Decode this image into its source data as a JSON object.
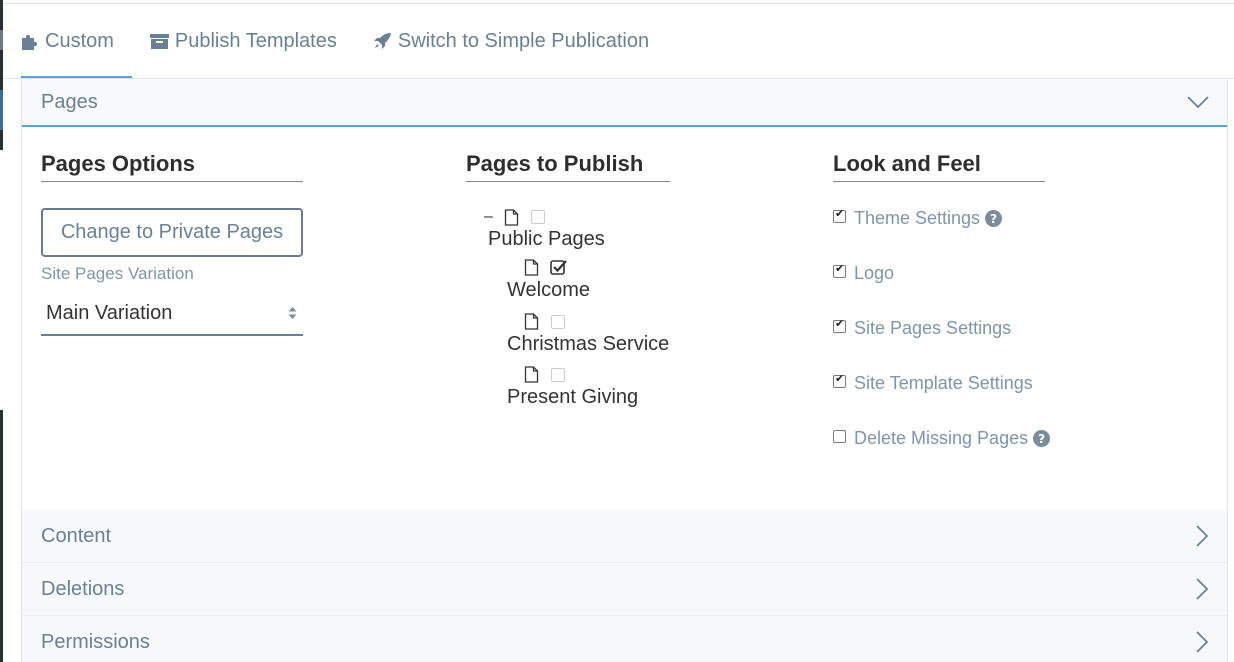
{
  "topnav": {
    "tabs": [
      {
        "label": "Custom",
        "icon": "puzzle-icon",
        "active": true
      },
      {
        "label": "Publish Templates",
        "icon": "archive-icon"
      },
      {
        "label": "Switch to Simple Publication",
        "icon": "rocket-icon"
      }
    ]
  },
  "sections": {
    "pages": {
      "title": "Pages"
    },
    "content": {
      "title": "Content"
    },
    "deletions": {
      "title": "Deletions"
    },
    "permissions": {
      "title": "Permissions"
    }
  },
  "pages_options": {
    "heading": "Pages Options",
    "change_button": "Change to Private Pages",
    "variation_label": "Site Pages Variation",
    "variation_value": "Main Variation"
  },
  "pages_to_publish": {
    "heading": "Pages to Publish",
    "collapse_symbol": "–",
    "root": {
      "label": "Public Pages",
      "checked": false
    },
    "children": [
      {
        "label": "Welcome",
        "checked": true
      },
      {
        "label": "Christmas Service",
        "checked": false
      },
      {
        "label": "Present Giving",
        "checked": false
      }
    ]
  },
  "look_and_feel": {
    "heading": "Look and Feel",
    "items": [
      {
        "label": "Theme Settings",
        "checked": true,
        "help": "?"
      },
      {
        "label": "Logo",
        "checked": true
      },
      {
        "label": "Site Pages Settings",
        "checked": true
      },
      {
        "label": "Site Template Settings",
        "checked": true
      },
      {
        "label": "Delete Missing Pages",
        "checked": false,
        "help": "?"
      }
    ]
  },
  "colors": {
    "accent": "#5aa3d8",
    "muted_text": "#6a8094"
  }
}
